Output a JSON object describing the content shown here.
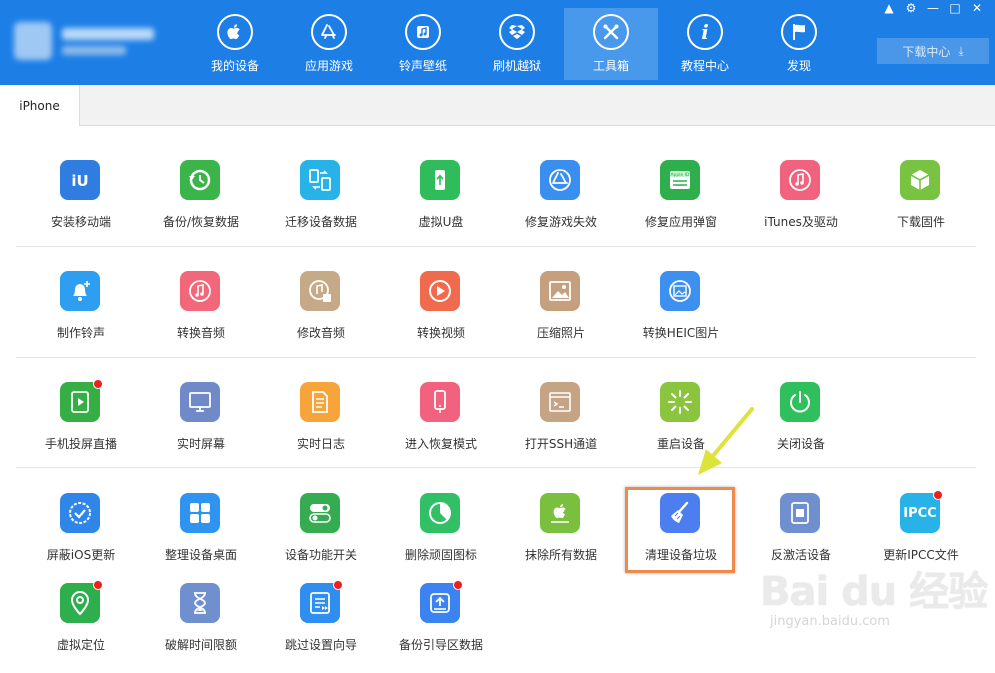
{
  "nav": [
    {
      "label": "我的设备",
      "icon": "apple-icon"
    },
    {
      "label": "应用游戏",
      "icon": "app-store-icon"
    },
    {
      "label": "铃声壁纸",
      "icon": "music-icon"
    },
    {
      "label": "刷机越狱",
      "icon": "dropbox-box-icon"
    },
    {
      "label": "工具箱",
      "icon": "tools-icon"
    },
    {
      "label": "教程中心",
      "icon": "info-icon"
    },
    {
      "label": "发现",
      "icon": "flag-icon"
    }
  ],
  "download_button": "下载中心",
  "tab": "iPhone",
  "tools": [
    {
      "label": "安装移动端",
      "icon": "iu-logo-icon",
      "color": "#2f7de1"
    },
    {
      "label": "备份/恢复数据",
      "icon": "backup-restore-icon",
      "color": "#3bb54a"
    },
    {
      "label": "迁移设备数据",
      "icon": "migrate-icon",
      "color": "#28b3e8"
    },
    {
      "label": "虚拟U盘",
      "icon": "usb-drive-icon",
      "color": "#2ebd5a"
    },
    {
      "label": "修复游戏失效",
      "icon": "app-store-icon",
      "color": "#3a8ef0"
    },
    {
      "label": "修复应用弹窗",
      "icon": "apple-id-icon",
      "color": "#2fae4e"
    },
    {
      "label": "iTunes及驱动",
      "icon": "itunes-icon",
      "color": "#f0627d"
    },
    {
      "label": "下载固件",
      "icon": "cube-icon",
      "color": "#78c442"
    },
    {
      "label": "制作铃声",
      "icon": "bell-icon",
      "color": "#2e9ef0"
    },
    {
      "label": "转换音频",
      "icon": "music-note-icon",
      "color": "#f2677a"
    },
    {
      "label": "修改音频",
      "icon": "edit-audio-icon",
      "color": "#c6a987"
    },
    {
      "label": "转换视频",
      "icon": "play-icon",
      "color": "#f06b4d"
    },
    {
      "label": "压缩照片",
      "icon": "image-icon",
      "color": "#c69f7e"
    },
    {
      "label": "转换HEIC图片",
      "icon": "heic-image-icon",
      "color": "#3d8ff0"
    },
    {
      "label": "手机投屏直播",
      "icon": "screen-cast-icon",
      "color": "#35ae46",
      "badge": true
    },
    {
      "label": "实时屏幕",
      "icon": "monitor-icon",
      "color": "#7089c9"
    },
    {
      "label": "实时日志",
      "icon": "log-icon",
      "color": "#f7a53a"
    },
    {
      "label": "进入恢复模式",
      "icon": "recovery-phone-icon",
      "color": "#f0627d"
    },
    {
      "label": "打开SSH通道",
      "icon": "terminal-icon",
      "color": "#c5a486"
    },
    {
      "label": "重启设备",
      "icon": "restart-icon",
      "color": "#8bc43f"
    },
    {
      "label": "关闭设备",
      "icon": "power-icon",
      "color": "#2fbf5c"
    },
    {
      "label": "屏蔽iOS更新",
      "icon": "block-update-icon",
      "color": "#2f85e8"
    },
    {
      "label": "整理设备桌面",
      "icon": "grid-icon",
      "color": "#2e94ef"
    },
    {
      "label": "设备功能开关",
      "icon": "toggle-icon",
      "color": "#35ac52"
    },
    {
      "label": "删除顽固图标",
      "icon": "pie-icon",
      "color": "#32c067"
    },
    {
      "label": "抹除所有数据",
      "icon": "erase-apple-icon",
      "color": "#7bbf3f"
    },
    {
      "label": "清理设备垃圾",
      "icon": "broom-icon",
      "color": "#4d7ef0"
    },
    {
      "label": "反激活设备",
      "icon": "deactivate-icon",
      "color": "#6f8fcf"
    },
    {
      "label": "更新IPCC文件",
      "icon": "ipcc-icon",
      "color": "#28b3e8",
      "badge": true
    },
    {
      "label": "虚拟定位",
      "icon": "location-pin-icon",
      "color": "#2fae4e",
      "badge": true
    },
    {
      "label": "破解时间限额",
      "icon": "hourglass-icon",
      "color": "#6f8fcf"
    },
    {
      "label": "跳过设置向导",
      "icon": "skip-setup-icon",
      "color": "#2f8ef0",
      "badge": true
    },
    {
      "label": "备份引导区数据",
      "icon": "backup-boot-icon",
      "color": "#3a83f0",
      "badge": true
    }
  ],
  "ipcc_text": "IPCC",
  "watermark": {
    "main": "Bai du 经验",
    "sub": "jingyan.baidu.com"
  }
}
